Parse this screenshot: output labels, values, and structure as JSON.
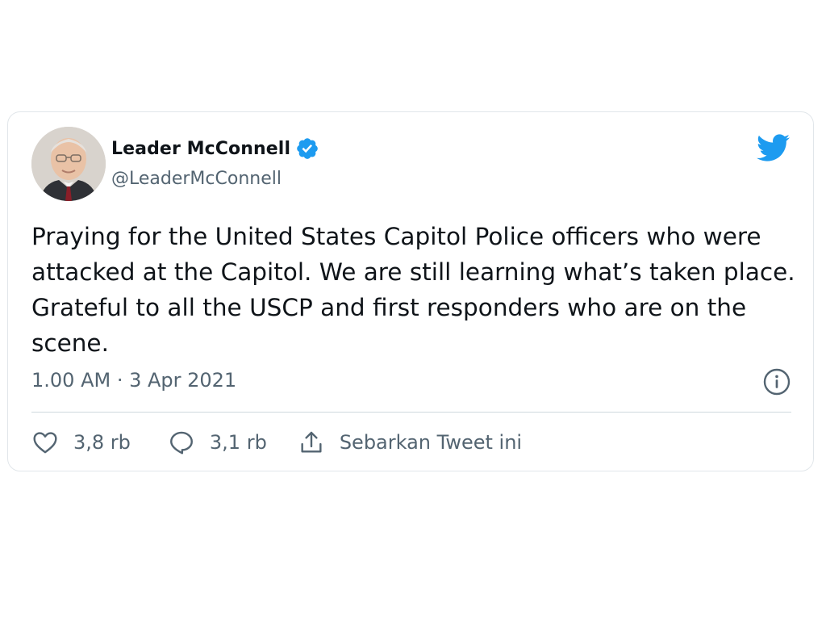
{
  "tweet": {
    "author": {
      "display_name": "Leader McConnell",
      "handle": "@LeaderMcConnell",
      "verified": true
    },
    "text": "Praying for the United States Capitol Police officers who were attacked at the Capitol. We are still learning what’s taken place. Grateful to all the USCP and first responders who are on the scene.",
    "timestamp": "1.00 AM · 3 Apr 2021",
    "actions": {
      "likes": "3,8 rb",
      "replies": "3,1 rb",
      "share_label": "Sebarkan Tweet ini"
    }
  },
  "icons": {
    "brand": "twitter-bird-icon",
    "verified": "verified-badge-icon",
    "info": "info-icon",
    "like": "heart-icon",
    "reply": "reply-bubble-icon",
    "share": "share-icon"
  },
  "colors": {
    "brand": "#1d9bf0",
    "text": "#0f1419",
    "secondary": "#536471",
    "border": "#e1e6ea",
    "divider": "#cfd9de"
  }
}
